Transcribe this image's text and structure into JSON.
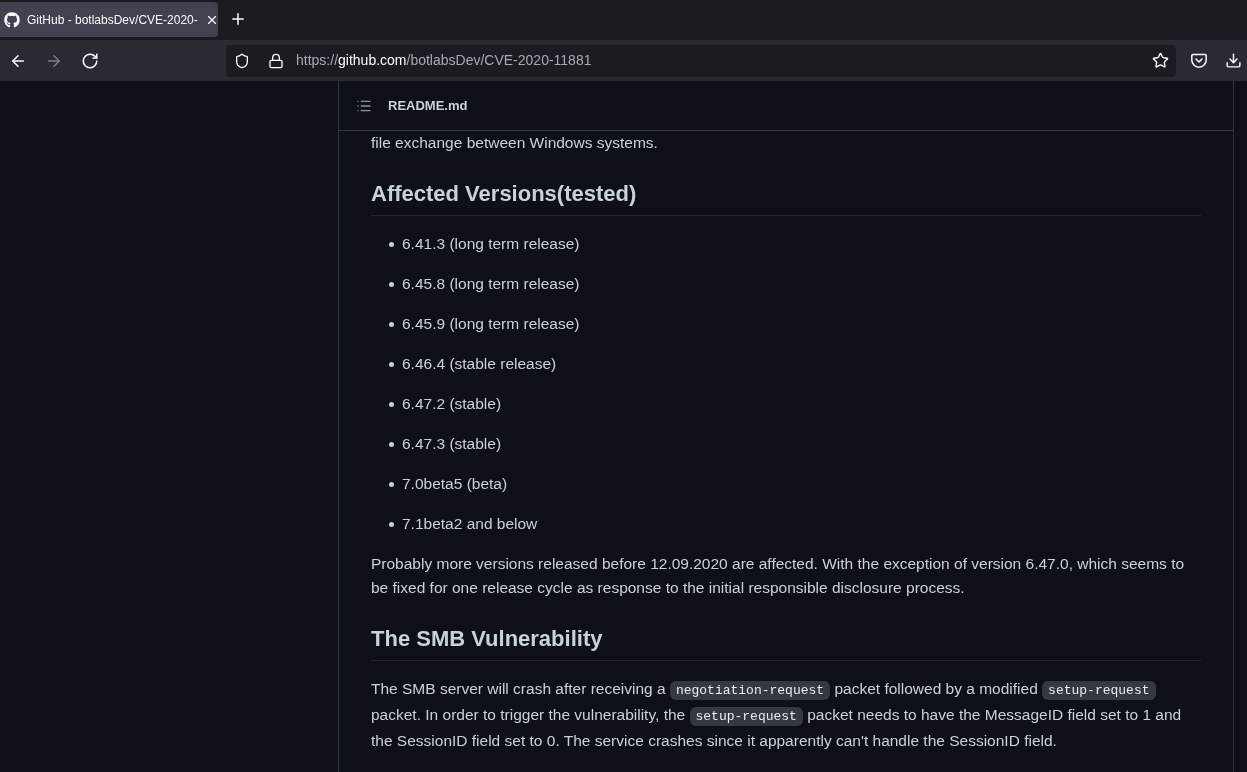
{
  "browser": {
    "tabs": [
      {
        "title": "GitHub - botlabsDev/CVE-2020-",
        "selected": true
      }
    ],
    "nav_buttons": [
      {
        "kind": "back",
        "disabled": false
      },
      {
        "kind": "forward",
        "disabled": true
      },
      {
        "kind": "reload",
        "disabled": false
      }
    ],
    "address_bar": {
      "scheme": "https://",
      "host": "github.com",
      "path": "/botlabsDev/CVE-2020-11881"
    }
  },
  "readme": {
    "filename": "README.md",
    "blocks": [
      {
        "kind": "paragraph",
        "segments": [
          {
            "kind": "text",
            "text": "file exchange between Windows systems."
          }
        ]
      },
      {
        "kind": "heading",
        "text": "Affected Versions(tested)"
      },
      {
        "kind": "list",
        "items": [
          "6.41.3 (long term release)",
          "6.45.8 (long term release)",
          "6.45.9 (long term release)",
          "6.46.4 (stable release)",
          "6.47.2 (stable)",
          "6.47.3 (stable)",
          "7.0beta5 (beta)",
          "7.1beta2 and below"
        ]
      },
      {
        "kind": "paragraph",
        "segments": [
          {
            "kind": "text",
            "text": "Probably more versions released before 12.09.2020 are affected. With the exception of version 6.47.0, which seems to be fixed for one release cycle as response to the initial responsible disclosure process."
          }
        ]
      },
      {
        "kind": "heading",
        "text": "The SMB Vulnerability"
      },
      {
        "kind": "paragraph",
        "segments": [
          {
            "kind": "text",
            "text": "The SMB server will crash after receiving a "
          },
          {
            "kind": "code",
            "text": "negotiation-request"
          },
          {
            "kind": "text",
            "text": " packet followed by a modified "
          },
          {
            "kind": "code",
            "text": "setup-request"
          },
          {
            "kind": "text",
            "text": " packet. In order to trigger the vulnerability, the "
          },
          {
            "kind": "code",
            "text": "setup-request"
          },
          {
            "kind": "text",
            "text": " packet needs to have the MessageID field set to 1 and the SessionID field set to 0. The service crashes since it apparently can't handle the SessionID field."
          }
        ]
      }
    ]
  }
}
